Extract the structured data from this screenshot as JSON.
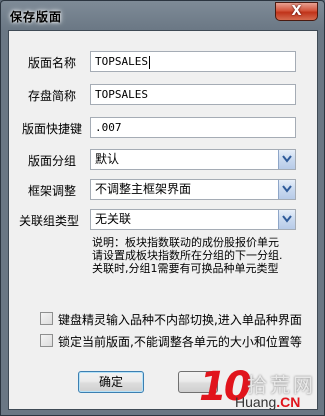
{
  "window": {
    "title": "保存版面",
    "close_glyph": "X"
  },
  "form": {
    "fields": [
      {
        "label": "版面名称",
        "value": "TOPSALES",
        "type": "text",
        "focused": true
      },
      {
        "label": "存盘简称",
        "value": "TOPSALES",
        "type": "text"
      },
      {
        "label": "版面快捷键",
        "value": ".007",
        "type": "text"
      },
      {
        "label": "版面分组",
        "value": "默认",
        "type": "combo"
      },
      {
        "label": "框架调整",
        "value": "不调整主框架界面",
        "type": "combo"
      },
      {
        "label": "关联组类型",
        "value": "无关联",
        "type": "combo"
      }
    ],
    "note_lines": [
      "说明：板块指数联动的成份股报价单元",
      "请设置成板块指数所在分组的下一分组.",
      "关联时,分组1需要有可换品种单元类型"
    ],
    "checkboxes": [
      {
        "label": "键盘精灵输入品种不内部切换,进入单品种界面",
        "checked": false
      },
      {
        "label": "锁定当前版面,不能调整各单元的大小和位置等",
        "checked": false
      }
    ],
    "buttons": {
      "ok": "确定"
    }
  },
  "watermark": {
    "number": "10",
    "cn_text": "拾荒网",
    "url_prefix": "Huang",
    "url_red": ".CN"
  },
  "colors": {
    "close_red": "#c0331a",
    "combo_arrow_blue": "#2e5a9a",
    "watermark_red": "#e1141c"
  },
  "icons": {
    "combo_arrow": "chevron-down-icon"
  }
}
